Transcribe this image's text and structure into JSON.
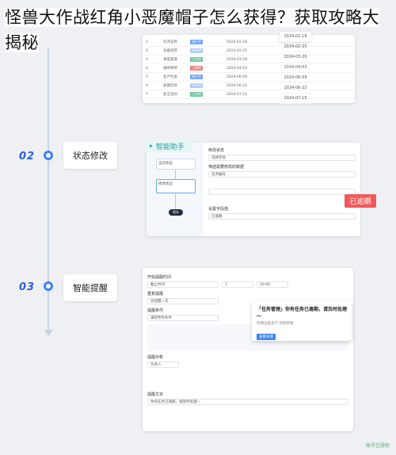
{
  "title": "怪兽大作战红角小恶魔帽子怎么获得？获取攻略大揭秘",
  "steps": [
    {
      "num": "02",
      "label": "状态修改"
    },
    {
      "num": "03",
      "label": "智能提醒"
    }
  ],
  "top_table": {
    "rows": [
      {
        "id": "1",
        "name": "任务名称",
        "status": "进行中",
        "date": "2024-02-18"
      },
      {
        "id": "2",
        "name": "设备巡检",
        "status": "待处理",
        "date": "2024-02-25"
      },
      {
        "id": "3",
        "name": "季度复盘",
        "status": "已完成",
        "date": "2024-03-20"
      },
      {
        "id": "4",
        "name": "维修保养",
        "status": "已逾期",
        "date": "2024-04-03"
      },
      {
        "id": "5",
        "name": "生产检查",
        "status": "进行中",
        "date": "2024-06-09"
      },
      {
        "id": "6",
        "name": "质量检验",
        "status": "待处理",
        "date": "2024-06-22"
      },
      {
        "id": "7",
        "name": "安全培训",
        "status": "已完成",
        "date": "2024-07-15"
      }
    ],
    "dates": [
      "2024-02-18",
      "2024-02-25",
      "2024-03-20",
      "2024-04-03",
      "2024-06-09",
      "2024-06-22",
      "2024-07-15"
    ]
  },
  "card2": {
    "ai_badge": "智能助手",
    "flow_nodes": [
      "当前状态",
      "修改状态",
      "保存"
    ],
    "fields": [
      {
        "label": "修改状态",
        "value": "选择字段"
      },
      {
        "label": "筛选需要修改的数据",
        "value": "任务编号"
      },
      {
        "label": "设置字段值",
        "value": "已逾期"
      }
    ],
    "overdue_tag": "已逾期"
  },
  "card3": {
    "fields": [
      {
        "label": "开始提醒时间",
        "value": "截止时间"
      },
      {
        "label": "重复提醒",
        "value": "日提醒一次"
      },
      {
        "label": "提醒条件",
        "value": "满足所有条件"
      },
      {
        "label": "提醒对象",
        "value": "负责人"
      },
      {
        "label": "提醒文本",
        "value": "你有任务已逾期，请及时处理～"
      }
    ],
    "time": "10:00",
    "count": "1"
  },
  "notification": {
    "title": "「任务管理」你有任务已逾期，请及时处理～",
    "subtitle": "到期设备生产·项目管理",
    "button": "查看详情"
  },
  "watermark": "账号已授权"
}
